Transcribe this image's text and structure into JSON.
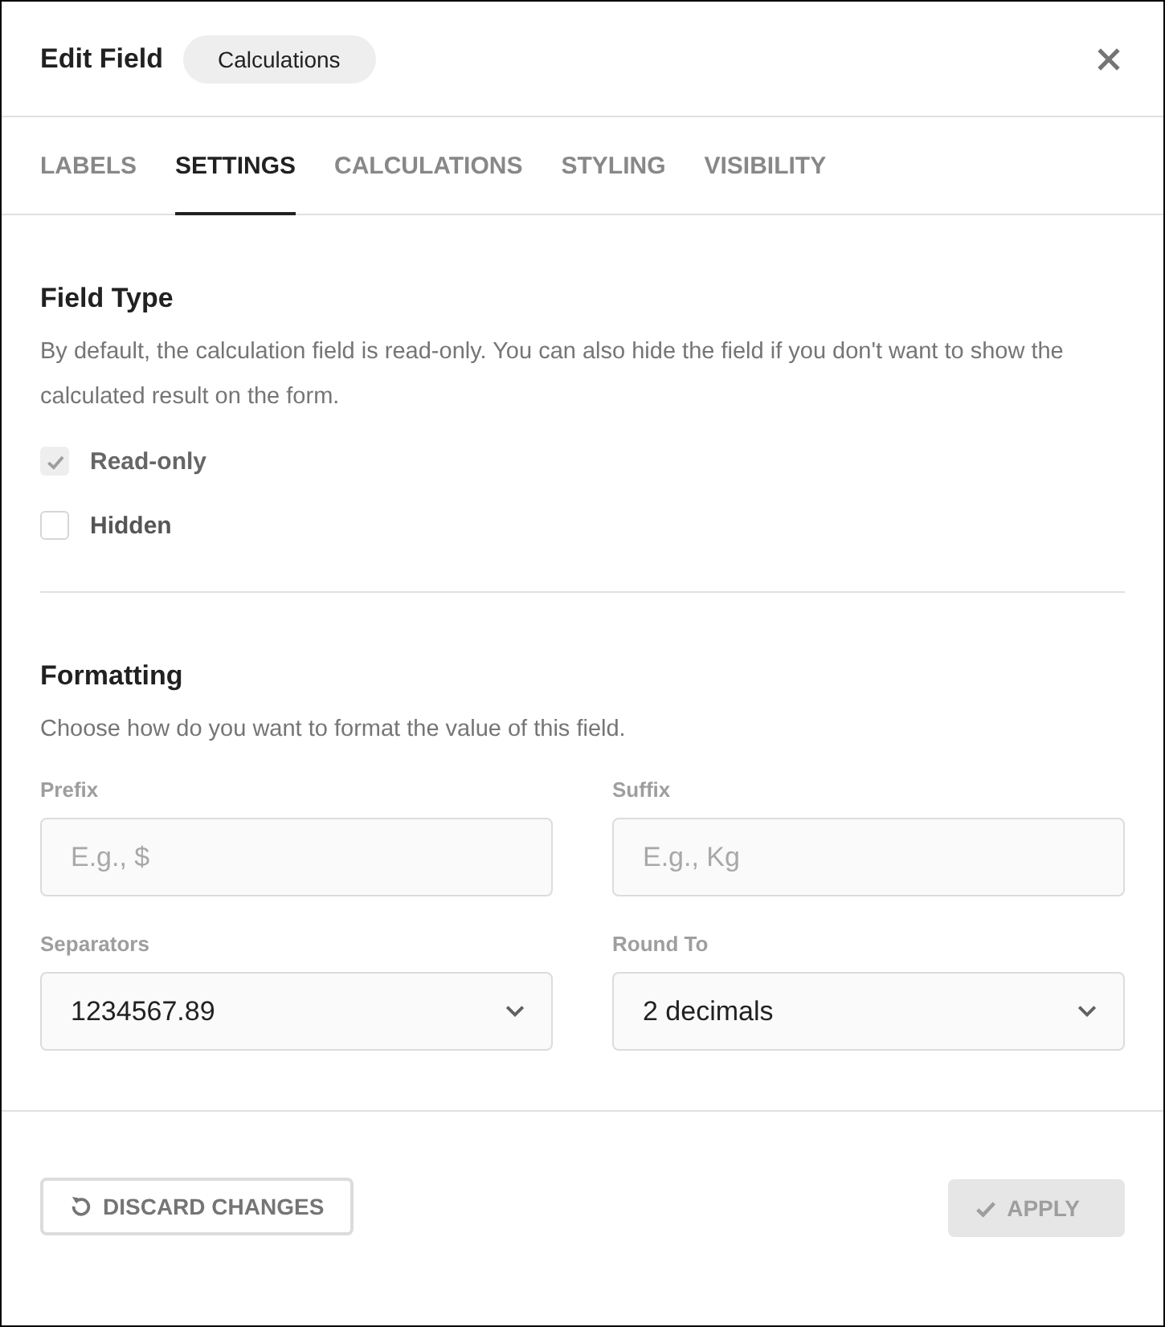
{
  "header": {
    "title": "Edit Field",
    "badge": "Calculations"
  },
  "tabs": [
    {
      "label": "LABELS",
      "selected": false
    },
    {
      "label": "SETTINGS",
      "selected": true
    },
    {
      "label": "CALCULATIONS",
      "selected": false
    },
    {
      "label": "STYLING",
      "selected": false
    },
    {
      "label": "VISIBILITY",
      "selected": false
    }
  ],
  "field_type": {
    "title": "Field Type",
    "description": "By default, the calculation field is read-only. You can also hide the field if you don't want to show the calculated result on the form.",
    "checkboxes": [
      {
        "label": "Read-only",
        "checked": true,
        "disabled": true
      },
      {
        "label": "Hidden",
        "checked": false,
        "disabled": false
      }
    ]
  },
  "formatting": {
    "title": "Formatting",
    "description": "Choose how do you want to format the value of this field.",
    "fields": [
      {
        "kind": "text",
        "label": "Prefix",
        "placeholder": "E.g., $"
      },
      {
        "kind": "text",
        "label": "Suffix",
        "placeholder": "E.g., Kg"
      },
      {
        "kind": "select",
        "label": "Separators",
        "value": "1234567.89"
      },
      {
        "kind": "select",
        "label": "Round To",
        "value": "2 decimals"
      }
    ]
  },
  "footer": {
    "discard_button": "DISCARD CHANGES",
    "apply_button": {
      "label": "APPLY",
      "disabled": true
    }
  }
}
